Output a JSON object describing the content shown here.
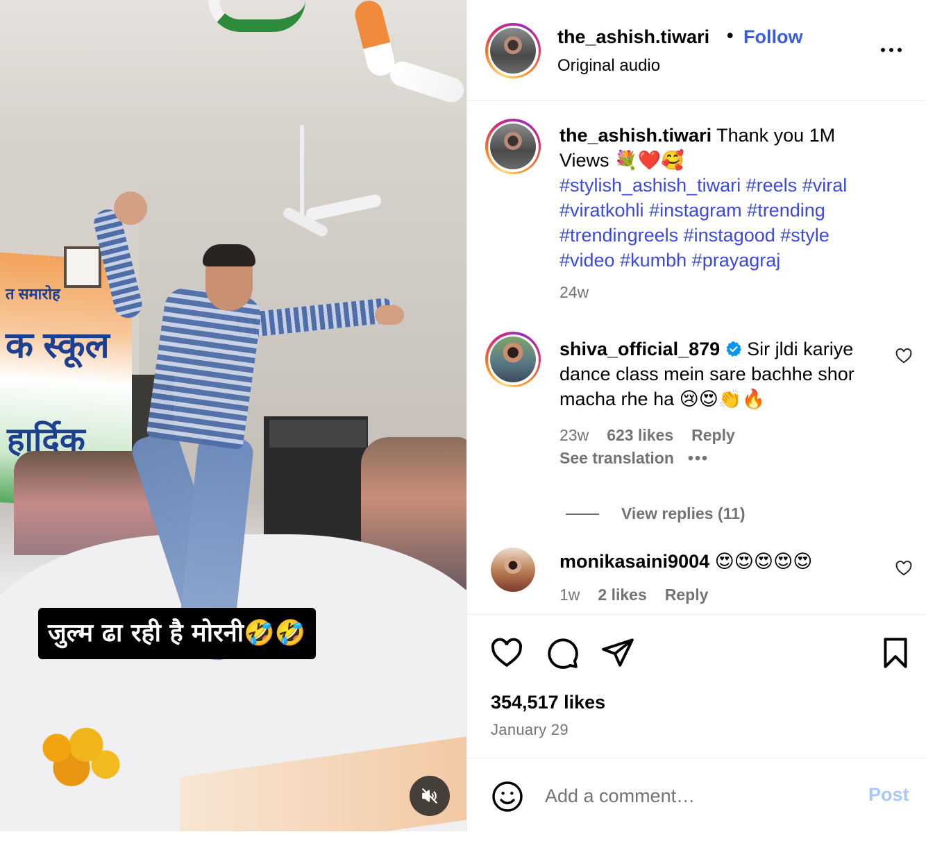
{
  "video": {
    "caption": "जुल्म ढा रही है मोरनी🤣🤣",
    "banner_line1": "त समारोह",
    "banner_line2": "क स्कूल",
    "banner_line3": "हार्दिक",
    "muted": true
  },
  "header": {
    "username": "the_ashish.tiwari",
    "separator": "•",
    "follow_label": "Follow",
    "audio": "Original audio"
  },
  "post": {
    "username": "the_ashish.tiwari",
    "text": "Thank you 1M Views 💐❤️🥰",
    "hashtags": [
      "#stylish_ashish_tiwari",
      "#reels",
      "#viral",
      "#viratkohli",
      "#instagram",
      "#trending",
      "#trendingreels",
      "#instagood",
      "#style",
      "#video",
      "#kumbh",
      "#prayagraj"
    ],
    "age": "24w"
  },
  "comments": [
    {
      "username": "shiva_official_879",
      "verified": true,
      "text": "Sir jldi kariye dance class mein sare bachhe shor macha rhe ha 😢😍👏🔥",
      "age": "23w",
      "likes": "623 likes",
      "reply_label": "Reply",
      "translation_label": "See translation",
      "more_label": "•••",
      "view_replies": "View replies (11)"
    },
    {
      "username": "monikasaini9004",
      "verified": false,
      "text": "😍😍😍😍😍",
      "age": "1w",
      "likes": "2 likes",
      "reply_label": "Reply"
    }
  ],
  "actions": {
    "icons": [
      "heart-icon",
      "comment-icon",
      "share-icon",
      "bookmark-icon"
    ],
    "likes": "354,517 likes",
    "date": "January 29"
  },
  "comment_box": {
    "placeholder": "Add a comment…",
    "post_label": "Post"
  },
  "colors": {
    "link": "#3b49df",
    "follow": "#3b5bdb",
    "muted_text": "#737373",
    "post_disabled": "#a9c8f6",
    "verified": "#0095f6"
  }
}
